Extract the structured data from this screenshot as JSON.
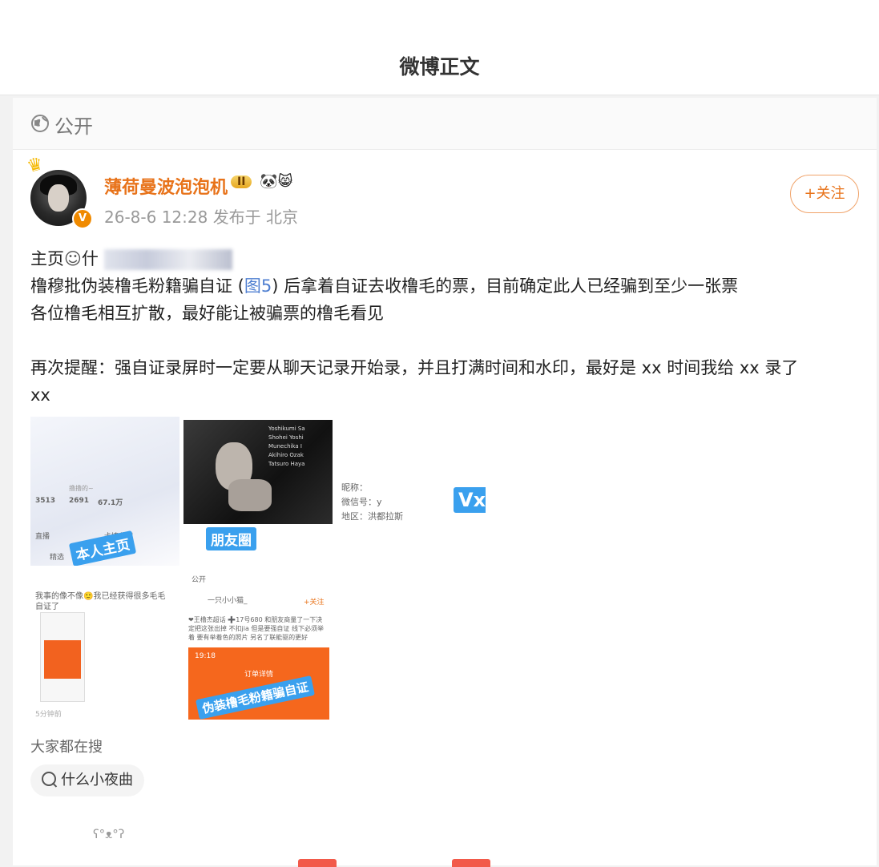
{
  "page": {
    "title": "微博正文"
  },
  "visibility": {
    "label": "公开",
    "icon": "globe-icon"
  },
  "post": {
    "username": "薄荷曼波泡泡机",
    "level_badge": "II",
    "emoji_badges": "🐼😸",
    "timestamp": "26-8-6 12:28",
    "location": "发布于 北京",
    "follow_label": "+关注",
    "text": {
      "line1_prefix": "主页",
      "line1_user_icon": "user-icon",
      "line1_partial": "什",
      "line2_before": "橹穆批伪装橹毛粉籍骗自证 (",
      "line2_link": "图5",
      "line2_after": ") 后拿着自证去收橹毛的票，目前确定此人已经骗到至少一张票",
      "line3": "各位橹毛相互扩散，最好能让被骗票的橹毛看见",
      "line4": "再次提醒：强自证录屏时一定要从聊天记录开始录，并且打满时间和水印，最好是 xx 时间我给 xx 录了",
      "line5": "xx"
    },
    "images": {
      "tile1": {
        "stamp": "本人主页",
        "stat1": "3513",
        "stat2": "2691",
        "stat3": "67.1万",
        "tab": "精选",
        "row1": "直播",
        "row2": "卡填收藏"
      },
      "tile2": {
        "stamp": "朋友圈",
        "credit1": "Yoshikumi Sa",
        "credit2": "Shohei Yoshi",
        "credit3": "Munechika I",
        "credit4": "Akihiro Ozak",
        "credit5": "Tatsuro Haya"
      },
      "tile3": {
        "nick_label": "昵称：",
        "wechat_label": "微信号：y",
        "region_label": "地区：洪都拉斯",
        "stamp": "Vx"
      },
      "tile4": {
        "caption": "我事的像不像🙂我已经获得很多毛毛自证了",
        "time": "5分钟前"
      },
      "tile5": {
        "header": "公开",
        "user": "一只小小猫_",
        "follow": "+关注",
        "body": "❤王橹杰超话 ➕17号680 和朋友商量了一下决定把这张出掉 不扣jia 但是要强自证 线下必须举着 要有举着色的照片 另名了联能驱的更好",
        "time": "19:18",
        "order": "订单详情",
        "stamp": "伪装橹毛粉籍骗自证"
      }
    }
  },
  "search": {
    "section_label": "大家都在搜",
    "pill_label": "什么小夜曲"
  },
  "footer": {
    "kaomoji": "ʕ°ᴥ°ʔ"
  }
}
